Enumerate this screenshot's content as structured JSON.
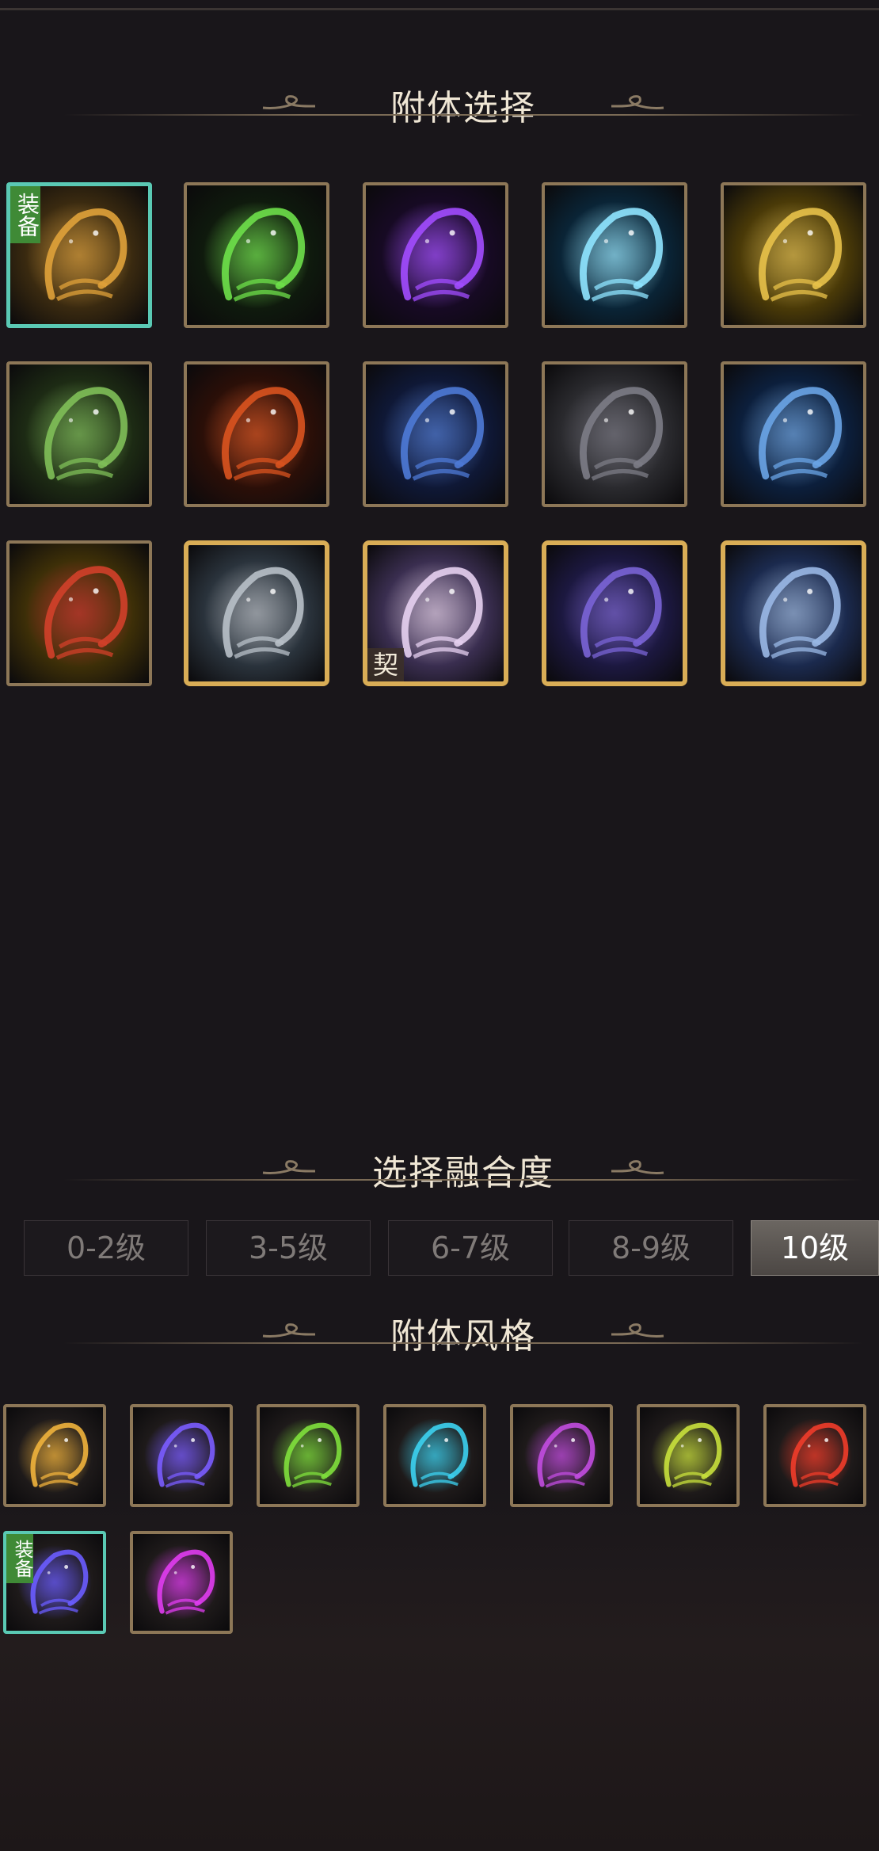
{
  "attach_section": {
    "title": "附体选择",
    "rows": [
      [
        {
          "name": "golden-crescent",
          "badge": "装备",
          "accent": "#e0a23a",
          "bg": "#3a2a10"
        },
        {
          "name": "green-flame",
          "badge": "",
          "accent": "#6ee04a",
          "bg": "#0f1a0d"
        },
        {
          "name": "violet-butterfly",
          "badge": "",
          "accent": "#a24cff",
          "bg": "#170a24"
        },
        {
          "name": "ice-crane",
          "badge": "",
          "accent": "#8fe4ff",
          "bg": "#0a2436"
        },
        {
          "name": "gold-phoenix",
          "badge": "",
          "accent": "#e8c24a",
          "bg": "#4a3a08"
        }
      ],
      [
        {
          "name": "green-wings",
          "badge": "",
          "accent": "#7fbf58",
          "bg": "#1d2b14"
        },
        {
          "name": "fire-figure",
          "badge": "",
          "accent": "#d9531f",
          "bg": "#2b0f08"
        },
        {
          "name": "azure-feathers",
          "badge": "",
          "accent": "#4e7ad6",
          "bg": "#0f1836"
        },
        {
          "name": "dark-crows",
          "badge": "",
          "accent": "#7c7c86",
          "bg": "#2a2a2e"
        },
        {
          "name": "frost-dragon",
          "badge": "",
          "accent": "#6aa4e6",
          "bg": "#0c1f3c"
        }
      ],
      [
        {
          "name": "crimson-phoenix",
          "badge": "",
          "accent": "#d2402a",
          "bg": "#3d2f08"
        },
        {
          "name": "silver-wings",
          "badge": "",
          "accent": "#b8c0c8",
          "bg": "#2a333c",
          "gold": true
        },
        {
          "name": "lotus-spirit",
          "badge": "契",
          "accent": "#e6d0f0",
          "bg": "#3a2e50",
          "gold": true
        },
        {
          "name": "starlight-wings",
          "badge": "",
          "accent": "#7a64d6",
          "bg": "#1c1840",
          "gold": true
        },
        {
          "name": "moon-crescent",
          "badge": "",
          "accent": "#9ab8e6",
          "bg": "#1b2a4e",
          "gold": true
        }
      ]
    ]
  },
  "fusion_section": {
    "title": "选择融合度",
    "levels": [
      "0-2级",
      "3-5级",
      "6-7级",
      "8-9级",
      "10级"
    ],
    "active_level": "10级"
  },
  "style_section": {
    "title": "附体风格",
    "styles": [
      {
        "name": "gold-style",
        "accent": "#f0b23c",
        "badge": ""
      },
      {
        "name": "indigo-style",
        "accent": "#7a5cff",
        "badge": ""
      },
      {
        "name": "lime-style",
        "accent": "#7fe03c",
        "badge": ""
      },
      {
        "name": "cyan-style",
        "accent": "#3cd2f0",
        "badge": ""
      },
      {
        "name": "purple-style",
        "accent": "#c24ce0",
        "badge": ""
      },
      {
        "name": "rainbow-style",
        "accent": "#c8e03c",
        "badge": ""
      },
      {
        "name": "red-style",
        "accent": "#f03c2a",
        "badge": ""
      },
      {
        "name": "blue-violet-style",
        "accent": "#6a5cff",
        "badge": "装备"
      },
      {
        "name": "magenta-style",
        "accent": "#e03cf0",
        "badge": ""
      }
    ]
  }
}
